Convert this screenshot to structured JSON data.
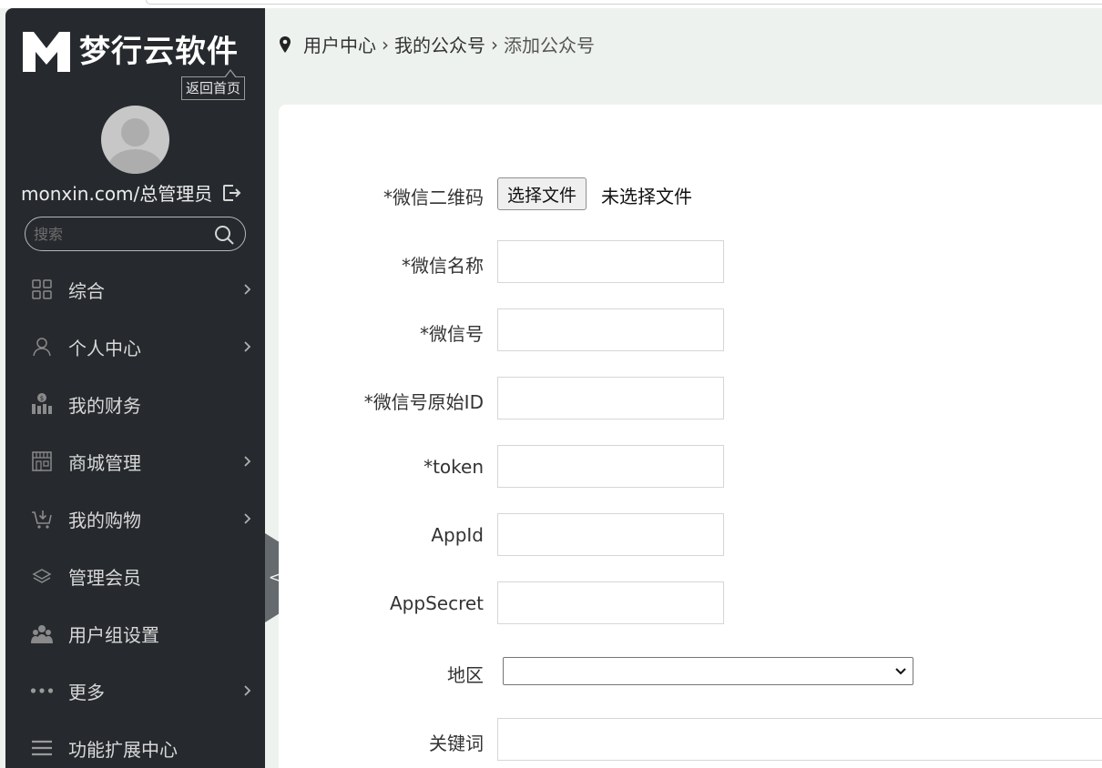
{
  "brand": {
    "name": "梦行云软件",
    "home_button": "返回首页"
  },
  "user": {
    "display_name": "monxin.com/总管理员"
  },
  "search": {
    "placeholder": "搜索"
  },
  "nav": {
    "items": [
      {
        "label": "综合",
        "icon": "grid-icon",
        "has_arrow": true
      },
      {
        "label": "个人中心",
        "icon": "person-icon",
        "has_arrow": true
      },
      {
        "label": "我的财务",
        "icon": "finance-icon",
        "has_arrow": false
      },
      {
        "label": "商城管理",
        "icon": "store-icon",
        "has_arrow": true
      },
      {
        "label": "我的购物",
        "icon": "cart-icon",
        "has_arrow": true
      },
      {
        "label": "管理会员",
        "icon": "layers-icon",
        "has_arrow": false
      },
      {
        "label": "用户组设置",
        "icon": "group-icon",
        "has_arrow": false
      },
      {
        "label": "更多",
        "icon": "more-dots-icon",
        "has_arrow": true
      },
      {
        "label": "功能扩展中心",
        "icon": "menu-lines-icon",
        "has_arrow": false
      }
    ],
    "collapse_label": "<"
  },
  "breadcrumb": {
    "items": [
      "用户中心",
      "我的公众号"
    ],
    "separator": "›",
    "current": "添加公众号"
  },
  "form": {
    "qrcode_label": "*微信二维码",
    "file_button": "选择文件",
    "file_status": "未选择文件",
    "name_label": "*微信名称",
    "name_value": "",
    "account_label": "*微信号",
    "account_value": "",
    "original_id_label": "*微信号原始ID",
    "original_id_value": "",
    "token_label": "*token",
    "token_value": "",
    "appid_label": "AppId",
    "appid_value": "",
    "appsecret_label": "AppSecret",
    "appsecret_value": "",
    "region_label": "地区",
    "region_value": "",
    "keywords_label": "关键词",
    "keywords_value": ""
  },
  "colors": {
    "sidebar_bg": "#262a2e",
    "page_bg": "#eef2ee",
    "content_bg": "#ffffff"
  }
}
